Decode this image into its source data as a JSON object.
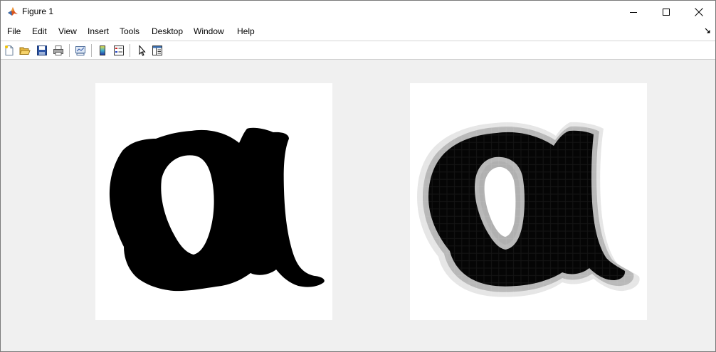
{
  "window": {
    "title": "Figure 1",
    "app_icon": "matlab-icon",
    "controls": [
      "minimize-icon",
      "maximize-icon",
      "close-icon"
    ]
  },
  "menubar": {
    "items": [
      "File",
      "Edit",
      "View",
      "Insert",
      "Tools",
      "Desktop",
      "Window",
      "Help"
    ],
    "dock_icon": "dock-arrow-icon"
  },
  "toolbar": {
    "buttons": [
      "new-figure-icon",
      "open-file-icon",
      "save-icon",
      "print-icon",
      "link-plot-icon",
      "insert-colorbar-icon",
      "insert-legend-icon",
      "edit-plot-icon",
      "property-inspector-icon"
    ]
  },
  "figure": {
    "axes": [
      {
        "content": "binary image of handwritten letter a",
        "colormap": "gray"
      },
      {
        "content": "low-resolution grayscale image of handwritten letter a",
        "colormap": "gray"
      }
    ]
  },
  "colors": {
    "figure_background": "#f0f0f0",
    "axes_background": "#ffffff",
    "ink": "#000000"
  }
}
